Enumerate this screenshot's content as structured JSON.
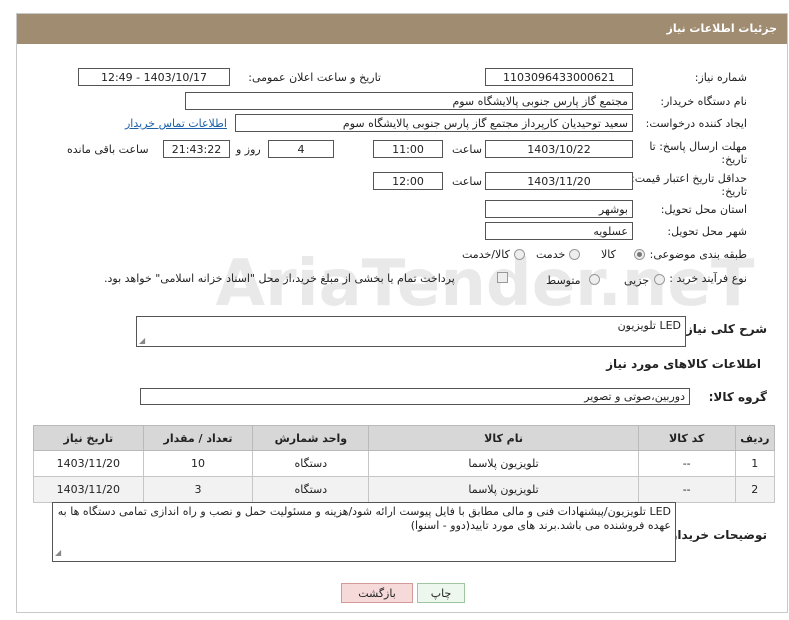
{
  "title": "جزئیات اطلاعات نیاز",
  "fields": {
    "need_number_label": "شماره نیاز:",
    "need_number": "1103096433000621",
    "announce_label": "تاریخ و ساعت اعلان عمومی:",
    "announce_value": "1403/10/17 - 12:49",
    "buyer_label": "نام دستگاه خریدار:",
    "buyer_value": "مجتمع گاز پارس جنوبی  پالایشگاه سوم",
    "creator_label": "ایجاد کننده درخواست:",
    "creator_value": "سعید توحیدیان کارپرداز مجتمع گاز پارس جنوبی  پالایشگاه سوم",
    "contact_link": "اطلاعات تماس خریدار",
    "reply_deadline_label1": "مهلت ارسال پاسخ: تا",
    "reply_deadline_label2": "تاریخ:",
    "reply_date": "1403/10/22",
    "hour_label": "ساعت",
    "reply_time": "11:00",
    "days_value": "4",
    "days_label": "روز و",
    "remaining_time": "21:43:22",
    "remaining_label": "ساعت باقی مانده",
    "price_validity_label1": "حداقل تاریخ اعتبار قیمت: تا",
    "price_validity_label2": "تاریخ:",
    "price_date": "1403/11/20",
    "price_hour_label": "ساعت",
    "price_time": "12:00",
    "province_label": "استان محل تحویل:",
    "province_value": "بوشهر",
    "city_label": "شهر محل تحویل:",
    "city_value": "عسلویه",
    "category_label": "طبقه بندی موضوعی:",
    "category_options": [
      "کالا",
      "خدمت",
      "کالا/خدمت"
    ],
    "category_selected": "کالا",
    "process_label": "نوع فرآیند خرید :",
    "process_options": [
      "جزیی",
      "متوسط"
    ],
    "process_selected": "",
    "payment_note": "پرداخت تمام یا بخشی از مبلغ خرید،از محل \"اسناد خزانه اسلامی\" خواهد بود."
  },
  "summary": {
    "label": "شرح کلی نیاز:",
    "value": "LED تلویزیون"
  },
  "goods_section_title": "اطلاعات کالاهای مورد نیاز",
  "goods_group": {
    "label": "گروه کالا:",
    "value": "دوربین،صوتی و تصویر"
  },
  "table": {
    "headers": [
      "ردیف",
      "کد کالا",
      "نام کالا",
      "واحد شمارش",
      "تعداد / مقدار",
      "تاریخ نیاز"
    ],
    "rows": [
      [
        "1",
        "--",
        "تلویزیون پلاسما",
        "دستگاه",
        "10",
        "1403/11/20"
      ],
      [
        "2",
        "--",
        "تلویزیون پلاسما",
        "دستگاه",
        "3",
        "1403/11/20"
      ]
    ]
  },
  "buyer_notes": {
    "label": "توضیحات خریدار:",
    "value": "LED تلویزیون/پیشنهادات فنی و مالی مطابق با فایل پیوست ارائه شود/هزینه و مسئولیت حمل و نصب و راه اندازی تمامی دستگاه ها به عهده فروشنده می باشد.برند های مورد تایید(دوو - اسنوا)"
  },
  "buttons": {
    "print": "چاپ",
    "back": "بازگشت"
  },
  "watermark_text": "AriaTender.neT",
  "colors": {
    "titlebar": "#a08c70",
    "back_button": "#f6dada",
    "print_button": "#eef7ee"
  }
}
